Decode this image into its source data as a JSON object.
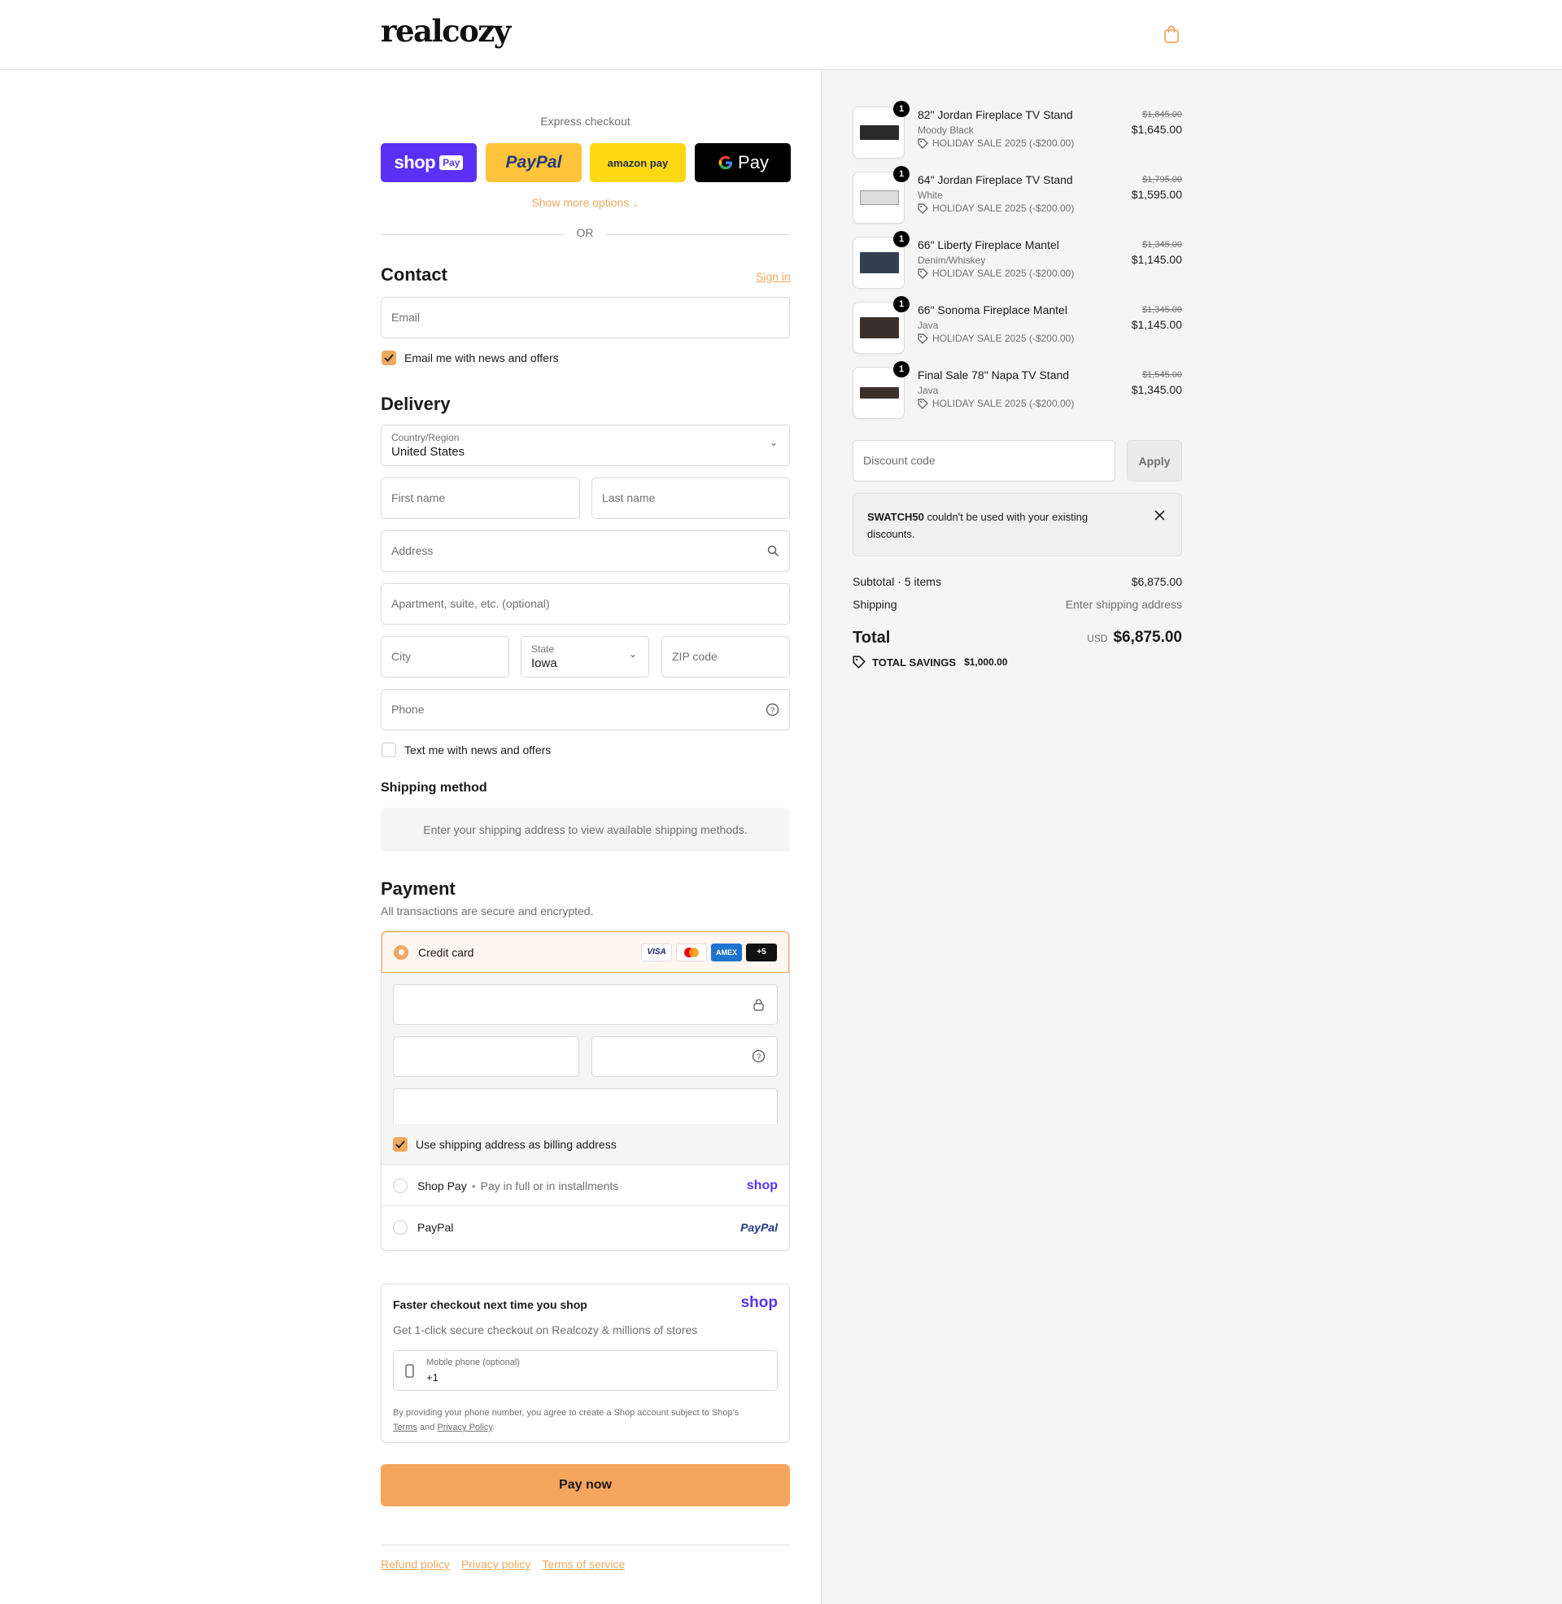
{
  "header": {
    "logo": "realcozy",
    "cart_icon": "shopping-bag-icon"
  },
  "express": {
    "title": "Express checkout",
    "buttons": {
      "shop": "shop",
      "shop_badge": "Pay",
      "paypal": "PayPal",
      "amazon": "amazon pay",
      "gpay": "Pay"
    },
    "show_more": "Show more options",
    "or": "OR"
  },
  "contact": {
    "title": "Contact",
    "sign_in": "Sign in",
    "email_placeholder": "Email",
    "news_label": "Email me with news and offers"
  },
  "delivery": {
    "title": "Delivery",
    "country_label": "Country/Region",
    "country_value": "United States",
    "first_name": "First name",
    "last_name": "Last name",
    "address": "Address",
    "apartment": "Apartment, suite, etc. (optional)",
    "city": "City",
    "state_label": "State",
    "state_value": "Iowa",
    "zip": "ZIP code",
    "phone": "Phone",
    "text_label": "Text me with news and offers"
  },
  "shipping": {
    "title": "Shipping method",
    "notice": "Enter your shipping address to view available shipping methods."
  },
  "payment": {
    "title": "Payment",
    "subtitle": "All transactions are secure and encrypted.",
    "credit_card": "Credit card",
    "cards": {
      "visa": "VISA",
      "amex": "AMEX",
      "more": "+5"
    },
    "billing_label": "Use shipping address as billing address",
    "shop_pay": "Shop Pay",
    "shop_pay_sub": "Pay in full or in installments",
    "shop_logo": "shop",
    "paypal": "PayPal",
    "paypal_logo": "PayPal"
  },
  "faster": {
    "title": "Faster checkout next time you shop",
    "logo": "shop",
    "subtitle": "Get 1-click secure checkout on Realcozy & millions of stores",
    "phone_label": "Mobile phone (optional)",
    "phone_value": "+1",
    "legal_pre": "By providing your phone number, you agree to create a Shop account subject to Shop's",
    "terms": "Terms",
    "and": "and",
    "privacy": "Privacy Policy"
  },
  "pay_now": "Pay now",
  "footer": {
    "refund": "Refund policy",
    "privacy": "Privacy policy",
    "terms": "Terms of service"
  },
  "order": {
    "items": [
      {
        "qty": "1",
        "name": "82\" Jordan Fireplace TV Stand",
        "variant": "Moody Black",
        "discount": "HOLIDAY SALE 2025 (-$200.00)",
        "old_price": "$1,845.00",
        "price": "$1,645.00"
      },
      {
        "qty": "1",
        "name": "64\" Jordan Fireplace TV Stand",
        "variant": "White",
        "discount": "HOLIDAY SALE 2025 (-$200.00)",
        "old_price": "$1,795.00",
        "price": "$1,595.00"
      },
      {
        "qty": "1",
        "name": "66\" Liberty Fireplace Mantel",
        "variant": "Denim/Whiskey",
        "discount": "HOLIDAY SALE 2025 (-$200.00)",
        "old_price": "$1,345.00",
        "price": "$1,145.00"
      },
      {
        "qty": "1",
        "name": "66\" Sonoma Fireplace Mantel",
        "variant": "Java",
        "discount": "HOLIDAY SALE 2025 (-$200.00)",
        "old_price": "$1,345.00",
        "price": "$1,145.00"
      },
      {
        "qty": "1",
        "name": "Final Sale 78\" Napa TV Stand",
        "variant": "Java",
        "discount": "HOLIDAY SALE 2025 (-$200.00)",
        "old_price": "$1,545.00",
        "price": "$1,345.00"
      }
    ],
    "discount_placeholder": "Discount code",
    "apply": "Apply",
    "alert_code": "SWATCH50",
    "alert_text": "couldn't be used with your existing discounts.",
    "subtotal_label": "Subtotal · 5 items",
    "subtotal": "$6,875.00",
    "shipping_label": "Shipping",
    "shipping_value": "Enter shipping address",
    "total_label": "Total",
    "currency": "USD",
    "total": "$6,875.00",
    "savings_label": "TOTAL SAVINGS",
    "savings": "$1,000.00"
  },
  "colors": {
    "accent": "#f0a860",
    "shop": "#5a31f4",
    "paypal_bg": "#ffc439",
    "amazon_bg": "#ffd814"
  }
}
